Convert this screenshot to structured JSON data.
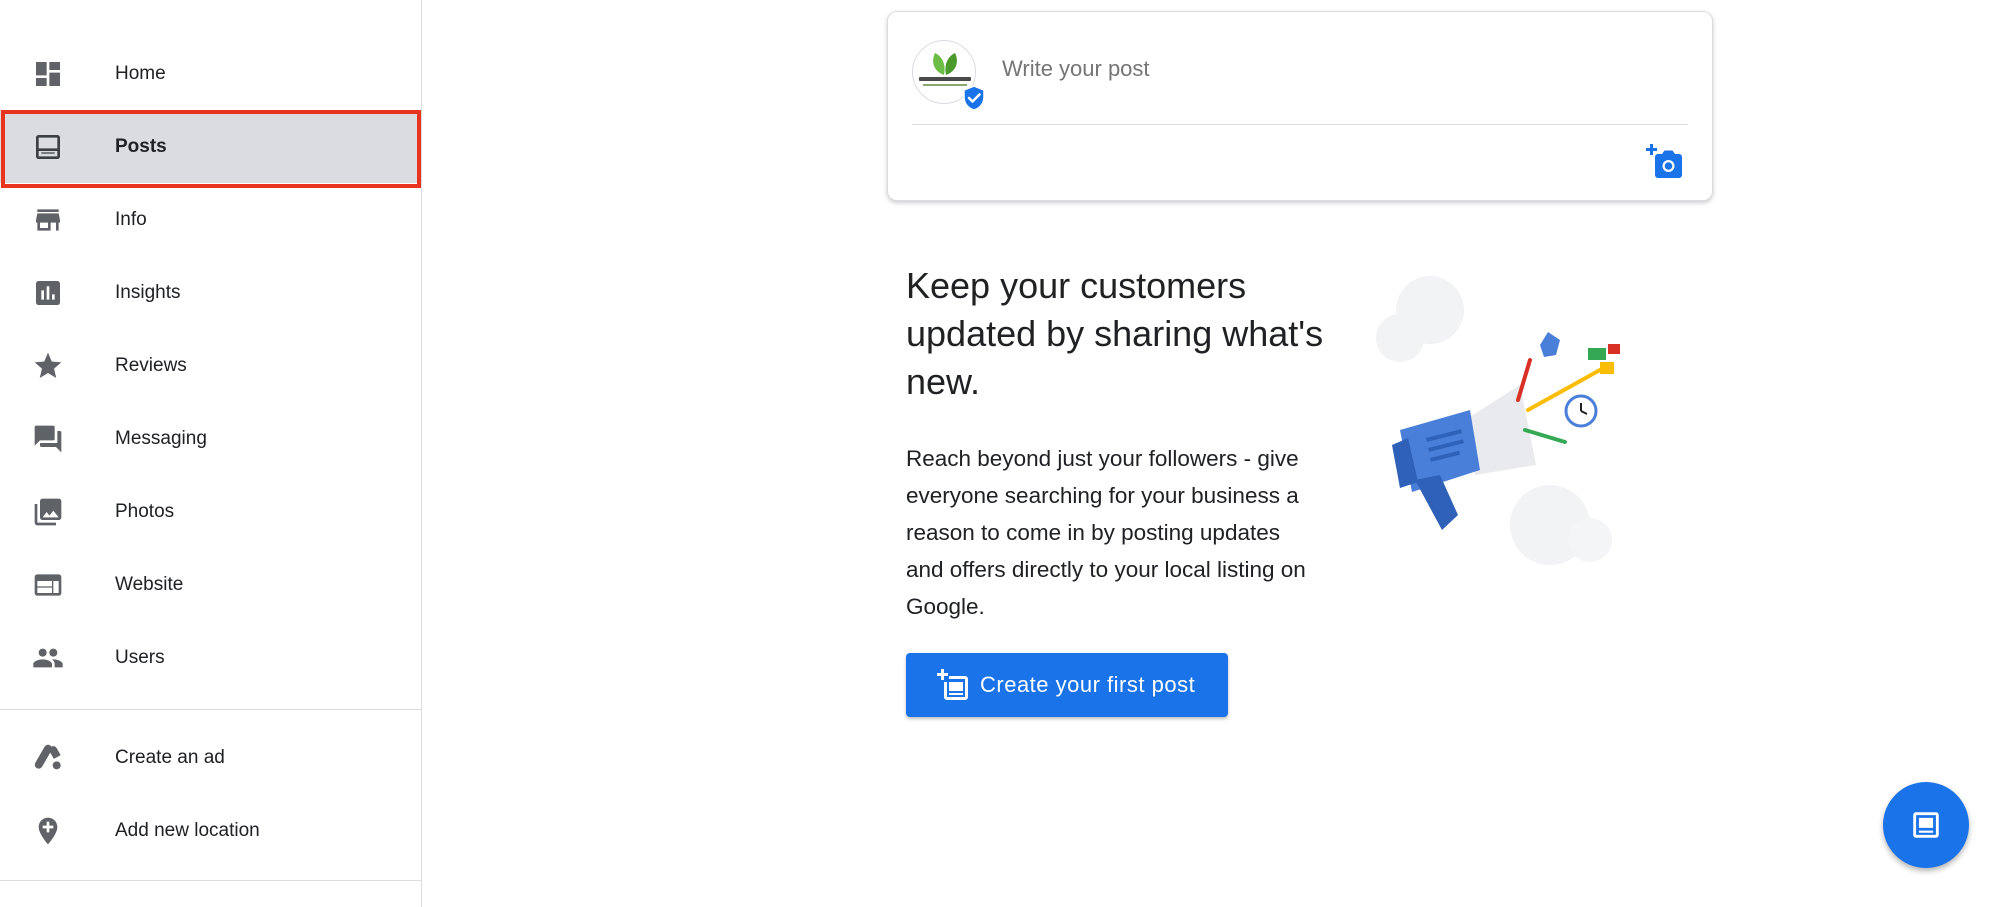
{
  "sidebar": {
    "items": [
      {
        "label": "Home",
        "icon": "dashboard-icon"
      },
      {
        "label": "Posts",
        "icon": "posts-icon",
        "active": true
      },
      {
        "label": "Info",
        "icon": "store-icon"
      },
      {
        "label": "Insights",
        "icon": "insights-icon"
      },
      {
        "label": "Reviews",
        "icon": "star-icon"
      },
      {
        "label": "Messaging",
        "icon": "chat-icon"
      },
      {
        "label": "Photos",
        "icon": "photos-icon"
      },
      {
        "label": "Website",
        "icon": "website-icon"
      },
      {
        "label": "Users",
        "icon": "users-icon"
      }
    ],
    "secondary_items": [
      {
        "label": "Create an ad",
        "icon": "google-ads-icon"
      },
      {
        "label": "Add new location",
        "icon": "add-location-icon"
      }
    ]
  },
  "composer": {
    "placeholder": "Write your post",
    "avatar_logo_icon": "leaf-logo-icon",
    "verified_icon": "verified-shield-icon",
    "add_photo_icon": "add-photo-icon"
  },
  "promo": {
    "title": "Keep your customers updated by sharing what's new.",
    "body": "Reach beyond just your followers - give everyone searching for your business a reason to come in by posting updates and offers directly to your local listing on Google.",
    "cta_label": "Create your first post",
    "illustration_icon": "megaphone-illustration"
  },
  "fab": {
    "icon": "create-post-icon"
  },
  "colors": {
    "accent": "#1a73e8",
    "highlight_border": "#e8331f",
    "active_bg": "#dadce0",
    "icon_gray": "#5f6368",
    "text": "#202124"
  }
}
